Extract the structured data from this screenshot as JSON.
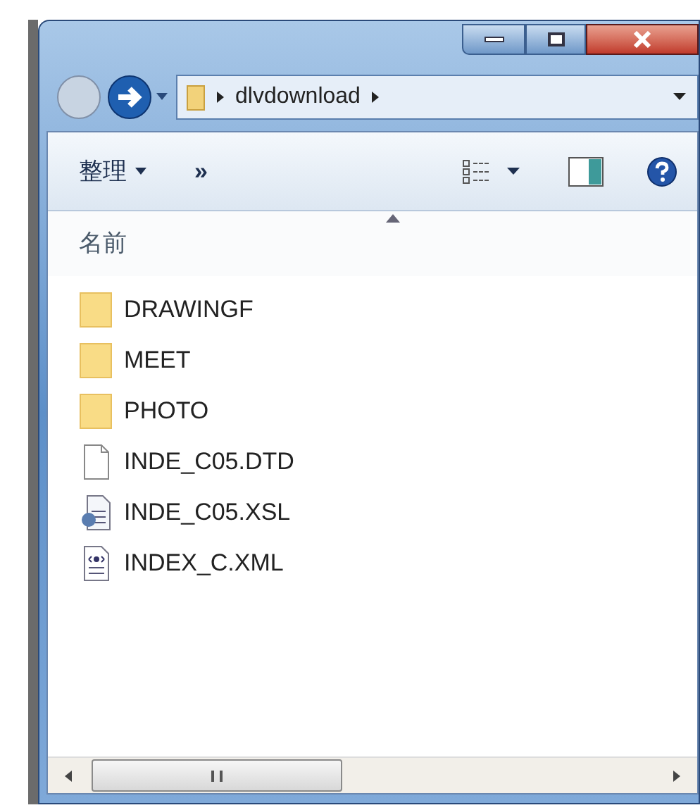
{
  "address_bar": {
    "path": "dlvdownload"
  },
  "toolbar": {
    "organize": "整理",
    "more": "»"
  },
  "column_header": "名前",
  "files": [
    {
      "name": "DRAWINGF",
      "kind": "folder"
    },
    {
      "name": "MEET",
      "kind": "folder"
    },
    {
      "name": "PHOTO",
      "kind": "folder"
    },
    {
      "name": "INDE_C05.DTD",
      "kind": "document"
    },
    {
      "name": "INDE_C05.XSL",
      "kind": "stylesheet"
    },
    {
      "name": "INDEX_C.XML",
      "kind": "xml"
    }
  ]
}
